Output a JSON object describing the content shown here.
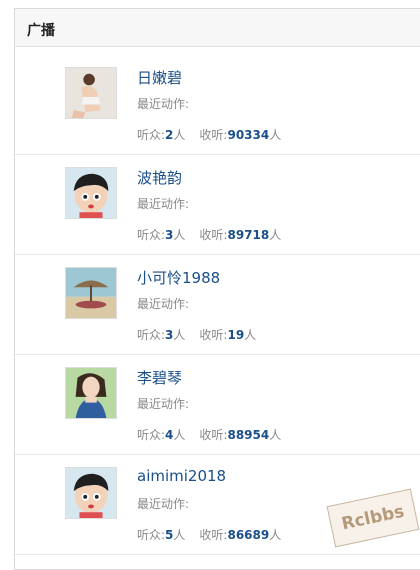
{
  "panel": {
    "title": "广播"
  },
  "labels": {
    "recent_action": "最近动作:",
    "listeners": "听众:",
    "following": "收听:",
    "person_unit": "人"
  },
  "users": [
    {
      "name": "日嫩碧",
      "listeners": "2",
      "following": "90334",
      "avatar": "photo-woman-icon"
    },
    {
      "name": "波艳韵",
      "listeners": "3",
      "following": "89718",
      "avatar": "cartoon-boy-icon"
    },
    {
      "name": "小可怜1988",
      "listeners": "3",
      "following": "19",
      "avatar": "beach-umbrella-icon"
    },
    {
      "name": "李碧琴",
      "listeners": "4",
      "following": "88954",
      "avatar": "photo-woman-icon"
    },
    {
      "name": "aimimi2018",
      "listeners": "5",
      "following": "86689",
      "avatar": "cartoon-boy-icon"
    }
  ],
  "watermark": "Rclbbs",
  "colors": {
    "link": "#1a4f8a",
    "muted": "#888888"
  }
}
